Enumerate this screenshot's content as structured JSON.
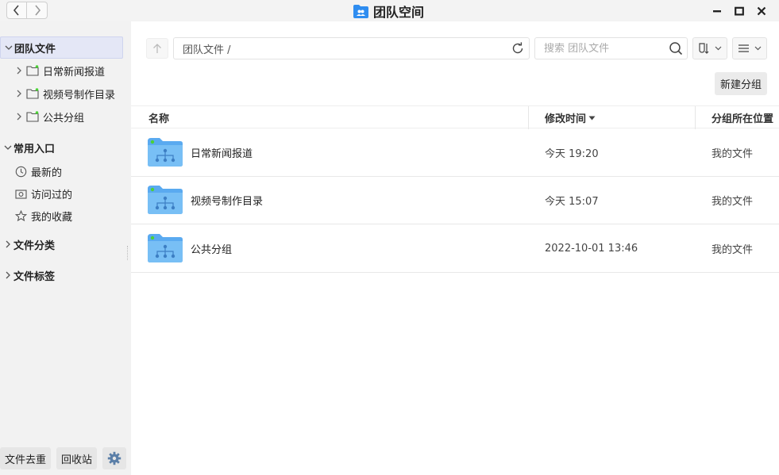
{
  "window": {
    "title": "团队空间"
  },
  "sidebar": {
    "team_section": "团队文件",
    "team_items": [
      {
        "label": "日常新闻报道"
      },
      {
        "label": "视频号制作目录"
      },
      {
        "label": "公共分组"
      }
    ],
    "common_section": "常用入口",
    "common_items": [
      {
        "label": "最新的",
        "icon": "clock-icon"
      },
      {
        "label": "访问过的",
        "icon": "eye-icon"
      },
      {
        "label": "我的收藏",
        "icon": "star-icon"
      }
    ],
    "category_section": "文件分类",
    "tags_section": "文件标签",
    "bottom": {
      "dedupe_label": "文件去重",
      "recycle_label": "回收站"
    }
  },
  "toolbar": {
    "path": "团队文件 /",
    "search_placeholder": "搜索 团队文件",
    "new_group_label": "新建分组"
  },
  "table": {
    "headers": {
      "name": "名称",
      "modified": "修改时间",
      "location": "分组所在位置"
    },
    "rows": [
      {
        "name": "日常新闻报道",
        "modified": "今天 19:20",
        "location": "我的文件"
      },
      {
        "name": "视频号制作目录",
        "modified": "今天 15:07",
        "location": "我的文件"
      },
      {
        "name": "公共分组",
        "modified": "2022-10-01 13:46",
        "location": "我的文件"
      }
    ]
  },
  "colors": {
    "folder": "#5aaaf0",
    "folder_dot": "#4cd137",
    "selected_bg": "#e4e7f6"
  }
}
